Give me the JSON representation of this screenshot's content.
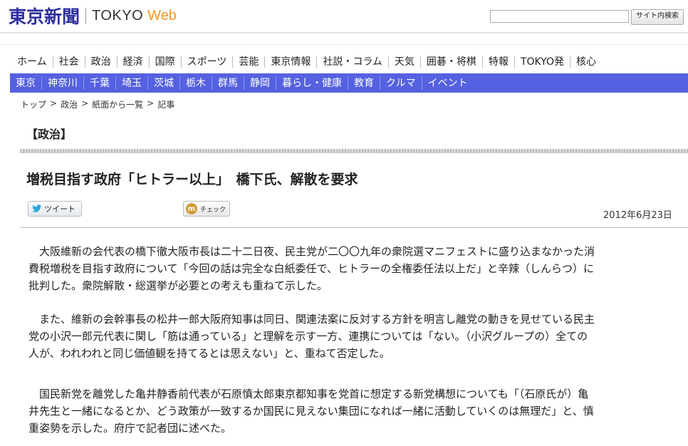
{
  "header": {
    "logo_kanji": "東京新聞",
    "logo_tokyo": "TOKYO",
    "logo_web": "Web",
    "search_placeholder": "",
    "search_button": "サイト内検索"
  },
  "main_nav": [
    "ホーム",
    "社会",
    "政治",
    "経済",
    "国際",
    "スポーツ",
    "芸能",
    "東京情報",
    "社説・コラム",
    "天気",
    "囲碁・将棋",
    "特報",
    "TOKYO発",
    "核心"
  ],
  "region_nav": [
    "東京",
    "神奈川",
    "千葉",
    "埼玉",
    "茨城",
    "栃木",
    "群馬",
    "静岡",
    "暮らし・健康",
    "教育",
    "クルマ",
    "イベント"
  ],
  "breadcrumb": [
    "トップ",
    ">",
    "政治",
    ">",
    "紙面から一覧",
    ">",
    "記事"
  ],
  "category": "【政治】",
  "headline": "増税目指す政府「ヒトラー以上」　橋下氏、解散を要求",
  "share": {
    "tweet": "ツイート",
    "check": "チェック"
  },
  "date": "2012年6月23日",
  "paragraphs": [
    [
      "　大阪維新の会代表の橋下徹大阪市長は二十二日夜、民主党が二〇〇九年の衆院選マニフェストに盛り込まなかった消",
      "費税増税を目指す政府について「今回の話は完全な白紙委任で、ヒトラーの全権委任法以上だ」と辛辣（しんらつ）に",
      "批判した。衆院解散・総選挙が必要との考えも重ねて示した。"
    ],
    [
      "　また、維新の会幹事長の松井一郎大阪府知事は同日、関連法案に反対する方針を明言し離党の動きを見せている民主",
      "党の小沢一郎元代表に関し「筋は通っている」と理解を示す一方、連携については「ない。（小沢グループの）全ての",
      "人が、われわれと同じ価値観を持てるとは思えない」と、重ねて否定した。"
    ],
    [
      "　国民新党を離党した亀井静香前代表が石原慎太郎東京都知事を党首に想定する新党構想についても「（石原氏が）亀",
      "井先生と一緒になるとか、どう政策が一致するか国民に見えない集団になれば一緒に活動していくのは無理だ」と、慎",
      "重姿勢を示した。府庁で記者団に述べた。"
    ]
  ]
}
